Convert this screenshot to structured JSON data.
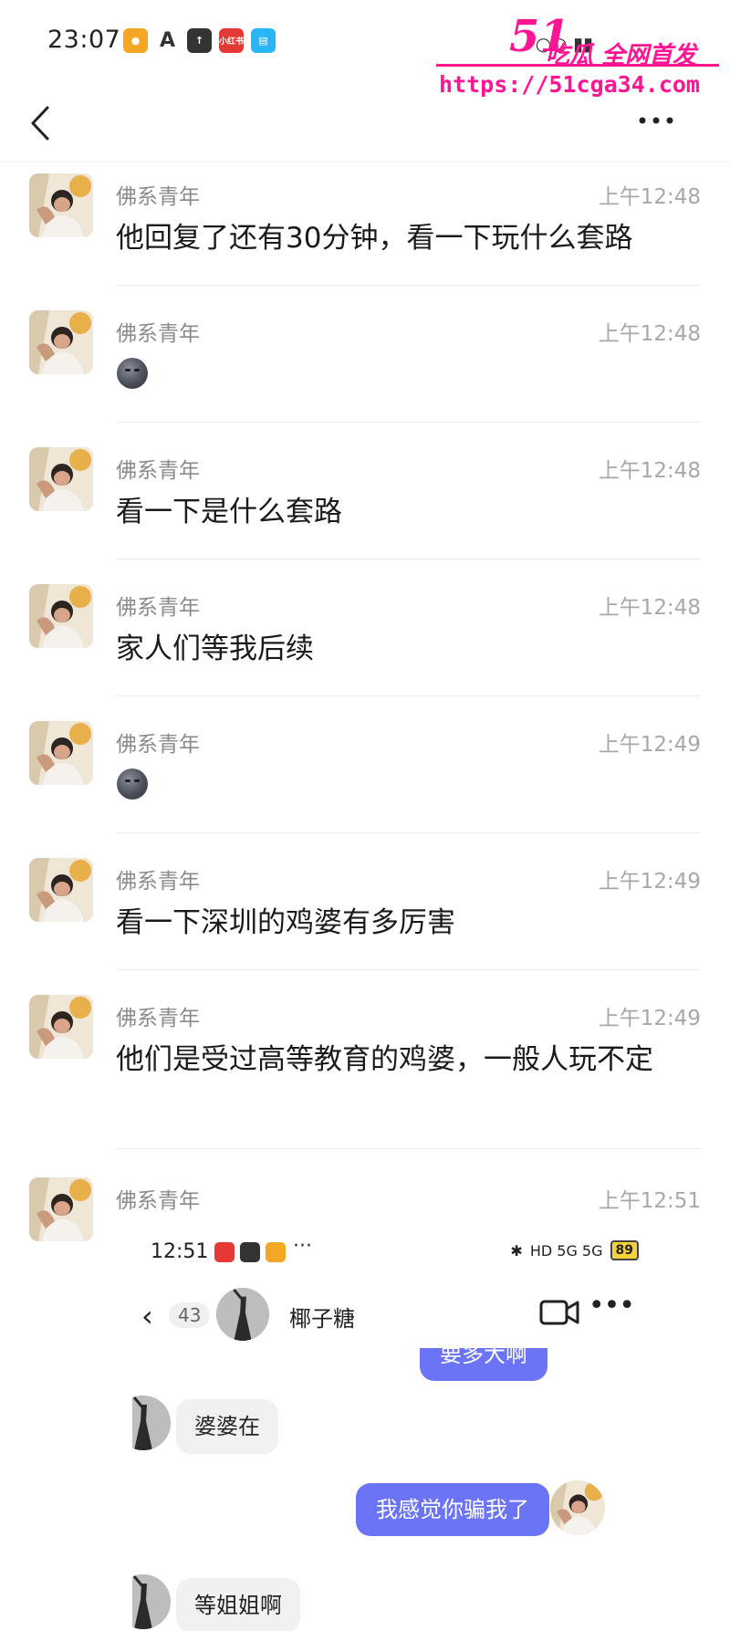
{
  "status_bar": {
    "time": "23:07",
    "apps": [
      {
        "name": "app-orange",
        "color": "#f5a623",
        "label": ""
      },
      {
        "name": "app-a",
        "color": "#444444",
        "label": "A"
      },
      {
        "name": "app-arrow",
        "color": "#333333",
        "label": "↑"
      },
      {
        "name": "app-red",
        "color": "#e53935",
        "label": "小红书"
      },
      {
        "name": "app-book",
        "color": "#29b6f6",
        "label": ""
      }
    ]
  },
  "watermark": {
    "logo": "51",
    "slogan": "吃瓜 全网首发",
    "url": "https://51cga34.com"
  },
  "header": {
    "back_icon": "chevron-left",
    "more_icon": "more-horizontal"
  },
  "messages": [
    {
      "sender": "佛系青年",
      "time": "上午12:48",
      "text": "他回复了还有30分钟，看一下玩什么套路",
      "emoji": false
    },
    {
      "sender": "佛系青年",
      "time": "上午12:48",
      "text": "",
      "emoji": true
    },
    {
      "sender": "佛系青年",
      "time": "上午12:48",
      "text": "看一下是什么套路",
      "emoji": false
    },
    {
      "sender": "佛系青年",
      "time": "上午12:48",
      "text": "家人们等我后续",
      "emoji": false
    },
    {
      "sender": "佛系青年",
      "time": "上午12:49",
      "text": "",
      "emoji": true
    },
    {
      "sender": "佛系青年",
      "time": "上午12:49",
      "text": "看一下深圳的鸡婆有多厉害",
      "emoji": false
    },
    {
      "sender": "佛系青年",
      "time": "上午12:49",
      "text": "他们是受过高等教育的鸡婆，一般人玩不定",
      "emoji": false
    },
    {
      "sender": "佛系青年",
      "time": "上午12:51",
      "text": "",
      "emoji": false
    }
  ],
  "embedded": {
    "time": "12:51",
    "battery": "89",
    "network": "HD 5G 5G",
    "back_count": "43",
    "peer_name": "椰子糖",
    "thread": [
      {
        "side": "out",
        "text": "要多大啊"
      },
      {
        "side": "in",
        "text": "婆婆在"
      },
      {
        "side": "out",
        "text": "我感觉你骗我了"
      },
      {
        "side": "in",
        "text": "等姐姐啊"
      }
    ]
  }
}
